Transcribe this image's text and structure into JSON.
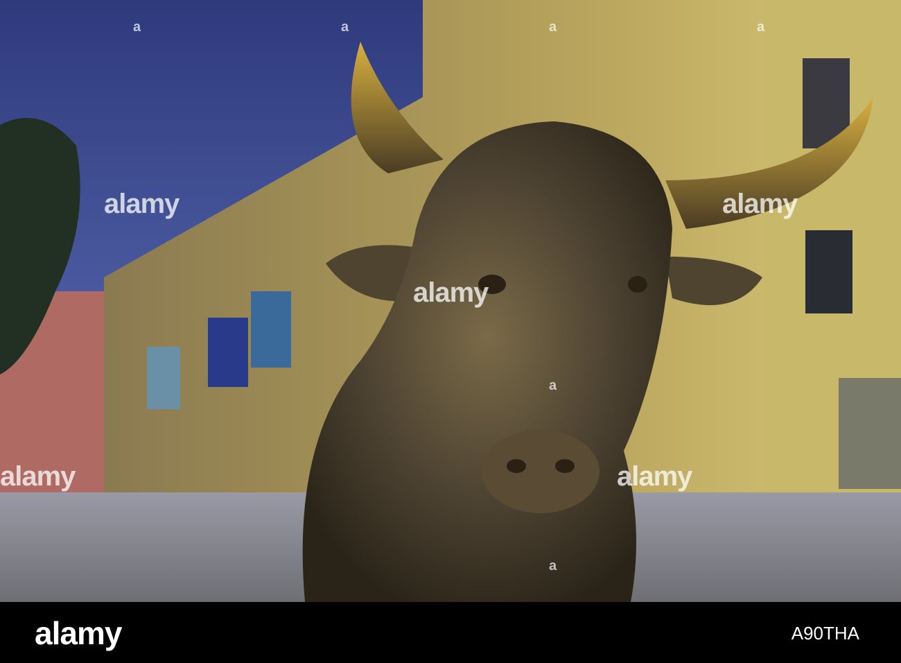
{
  "photo": {
    "subject": "bronze-bull-statue",
    "colors": {
      "sky": "#3d4a8a",
      "building": "#c9b25a",
      "bull": "#4a4030",
      "street": "#8a8c90"
    }
  },
  "watermark": {
    "text": "alamy",
    "mark": "a"
  },
  "footer": {
    "logo": "alamy",
    "image_id": "A90THA"
  }
}
